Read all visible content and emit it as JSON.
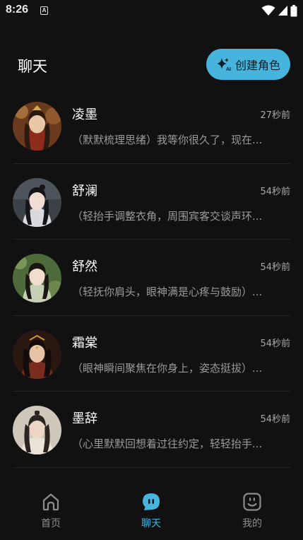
{
  "status_bar": {
    "time": "8:26",
    "a_icon": "A"
  },
  "header": {
    "title": "聊天",
    "create_button_label": "创建角色"
  },
  "chats": [
    {
      "name": "凌墨",
      "time": "27秒前",
      "preview": "（默默梳理思绪）我等你很久了，现在..."
    },
    {
      "name": "舒澜",
      "time": "54秒前",
      "preview": "（轻抬手调整衣角，周围宾客交谈声环..."
    },
    {
      "name": "舒然",
      "time": "54秒前",
      "preview": "（轻抚你肩头，眼神满是心疼与鼓励）..."
    },
    {
      "name": "霜棠",
      "time": "54秒前",
      "preview": "（眼神瞬间聚焦在你身上，姿态挺拔）..."
    },
    {
      "name": "墨辞",
      "time": "54秒前",
      "preview": "（心里默默回想着过往约定，轻轻抬手..."
    }
  ],
  "nav": {
    "home": "首页",
    "chat": "聊天",
    "me": "我的"
  },
  "colors": {
    "accent": "#46b4dc",
    "background": "#111111"
  }
}
